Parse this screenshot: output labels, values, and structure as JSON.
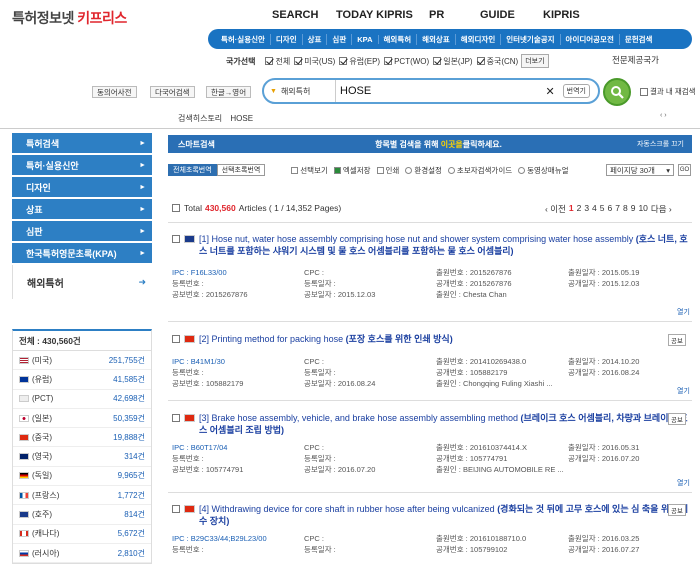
{
  "header": {
    "logo_part1": "특허정보넷",
    "logo_part2": "키프리스",
    "topnav": [
      "SEARCH",
      "TODAY KIPRIS",
      "PR",
      "GUIDE",
      "KIPRIS"
    ],
    "subnav": [
      "특허·실용신안",
      "디자인",
      "상표",
      "심판",
      "KPA",
      "해외특허",
      "해외상표",
      "해외디자인",
      "인터넷기술공지",
      "아이디어공모전",
      "문헌검색"
    ],
    "country_label": "국가선택",
    "countries": [
      "전체",
      "미국(US)",
      "유럽(EP)",
      "PCT(WO)",
      "일본(JP)",
      "중국(CN)"
    ],
    "country_more": "더보기",
    "expert_link": "전문제공국가",
    "btn_history": "동의어사전",
    "btn_multi": "다국어검색",
    "btn_lang": "한글→영어",
    "search_select": "해외특허",
    "search_value": "HOSE",
    "translate_btn": "번역기",
    "result_within": "결과 내 재검색",
    "history_label": "검색히스토리",
    "history_value": "HOSE",
    "history_arrows": "‹ ›"
  },
  "sidebar": {
    "items": [
      "특허검색",
      "특허·실용신안",
      "디자인",
      "상표",
      "심판",
      "한국특허영문초록(KPA)"
    ],
    "active": "해외특허",
    "total_label": "전체 : 430,560건",
    "stats": [
      {
        "flag": "us",
        "name": "(미국)",
        "count": "251,755건"
      },
      {
        "flag": "eu",
        "name": "(유럽)",
        "count": "41,585건"
      },
      {
        "flag": "pct",
        "name": "(PCT)",
        "count": "42,698건"
      },
      {
        "flag": "jp",
        "name": "(일본)",
        "count": "50,359건"
      },
      {
        "flag": "cn",
        "name": "(중국)",
        "count": "19,888건"
      },
      {
        "flag": "gb",
        "name": "(영국)",
        "count": "314건"
      },
      {
        "flag": "de",
        "name": "(독일)",
        "count": "9,965건"
      },
      {
        "flag": "fr",
        "name": "(프랑스)",
        "count": "1,772건"
      },
      {
        "flag": "au",
        "name": "(호주)",
        "count": "814건"
      },
      {
        "flag": "ca",
        "name": "(캐나다)",
        "count": "5,672건"
      },
      {
        "flag": "ru",
        "name": "(러시아)",
        "count": "2,810건"
      }
    ]
  },
  "content": {
    "smart_label": "스마트검색",
    "smart_text_pre": "항목별 검색을 위해",
    "smart_text_hl": "이곳을",
    "smart_text_post": "클릭하세요.",
    "smart_right": "자동스크롤 끄기",
    "tab1": "전체초록번역",
    "tab2": "선택초록번역",
    "tools": [
      "선택보기",
      "엑셀저장",
      "인쇄",
      "환경설정",
      "초보자검색가이드",
      "동영상매뉴얼"
    ],
    "per_page": "페이지당 30개",
    "go": "GO",
    "total_prefix": "Total",
    "total_count": "430,560",
    "total_suffix": "Articles ( 1 / 14,352 Pages)",
    "pager_prev": "‹ 이전",
    "pages": [
      "1",
      "2",
      "3",
      "4",
      "5",
      "6",
      "7",
      "8",
      "9",
      "10"
    ],
    "pager_next": "다음 ›",
    "results": [
      {
        "flag": "au",
        "title": "[1] Hose nut, water hose assembly comprising hose nut and shower system comprising water hose assembly",
        "kor": "(호스 너트, 호스 너트를 포함하는 샤워기 시스템 및 물 호스 어셈블리를 포함하는 물 호스 어셈블리)",
        "meta": [
          [
            "IPC : F16L33/00",
            "CPC :",
            "출원번호 : 2015267876",
            "출원일자 : 2015.05.19"
          ],
          [
            "등록번호 :",
            "등록일자 :",
            "공개번호 : 2015267876",
            "공개일자 : 2015.12.03"
          ],
          [
            "공보번호 : 2015267876",
            "공보일자 : 2015.12.03",
            "출원인 : Chesta Chan",
            ""
          ]
        ],
        "tag": ""
      },
      {
        "flag": "cn",
        "title": "[2] Printing method for packing hose",
        "kor": "(포장 호스를 위한 인쇄 방식)",
        "meta": [
          [
            "IPC : B41M1/30",
            "CPC :",
            "출원번호 : 201410269438.0",
            "출원일자 : 2014.10.20"
          ],
          [
            "등록번호 :",
            "등록일자 :",
            "공개번호 : 105882179",
            "공개일자 : 2016.08.24"
          ],
          [
            "공보번호 : 105882179",
            "공보일자 : 2016.08.24",
            "출원인 : Chongqing Fuling Xiashi ...",
            ""
          ]
        ],
        "tag": "공보"
      },
      {
        "flag": "cn",
        "title": "[3] Brake hose assembly, vehicle, and brake hose assembly assembling method",
        "kor": "(브레이크 호스 어셈블리, 차량과 브레이크 호스 어셈블리 조립 방법)",
        "meta": [
          [
            "IPC : B60T17/04",
            "CPC :",
            "출원번호 : 201610374414.X",
            "출원일자 : 2016.05.31"
          ],
          [
            "등록번호 :",
            "등록일자 :",
            "공개번호 : 105774791",
            "공개일자 : 2016.07.20"
          ],
          [
            "공보번호 : 105774791",
            "공보일자 : 2016.07.20",
            "출원인 : BEIJING AUTOMOBILE RE ...",
            ""
          ]
        ],
        "tag": "공보"
      },
      {
        "flag": "cn",
        "title": "[4] Withdrawing device for core shaft in rubber hose after being vulcanized",
        "kor": "(경화되는 것 뒤에 고무 호스에 있는 심 축을 위한 회수 장치)",
        "meta": [
          [
            "IPC : B29C33/44;B29L23/00",
            "CPC :",
            "출원번호 : 201610188710.0",
            "출원일자 : 2016.03.25"
          ],
          [
            "등록번호 :",
            "등록일자 :",
            "공개번호 : 105799102",
            "공개일자 : 2016.07.27"
          ]
        ],
        "tag": "공보"
      }
    ],
    "more_label": "열기"
  }
}
